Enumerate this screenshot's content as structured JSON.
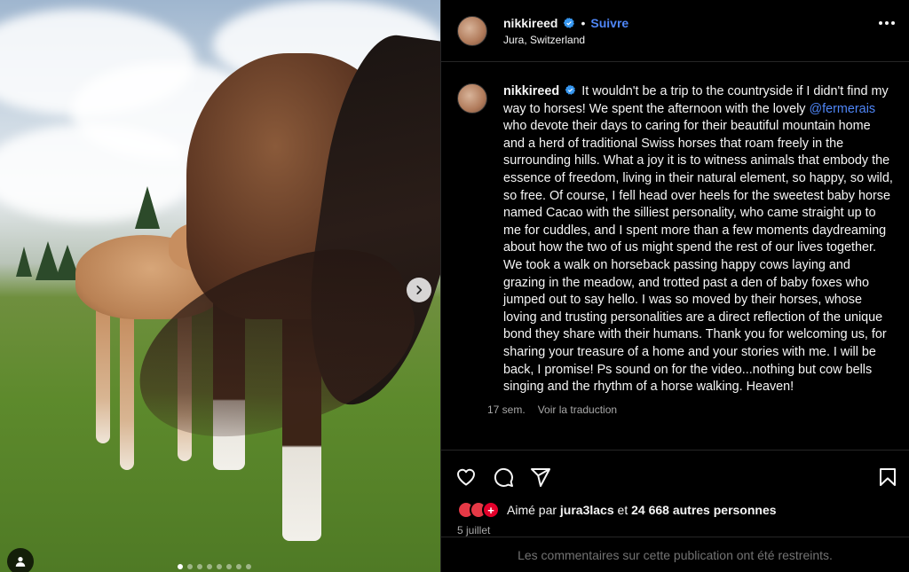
{
  "post": {
    "username": "nikkireed",
    "follow_label": "Suivre",
    "separator": "•",
    "location": "Jura, Switzerland",
    "caption_user": "nikkireed",
    "caption_before_mention": "It wouldn't be a trip to the countryside if I didn't find my way to horses! We spent the afternoon with the lovely ",
    "caption_mention": "@fermerais",
    "caption_after_mention": " who devote their days to caring for their beautiful mountain home and a herd of traditional Swiss horses that roam freely in the surrounding hills. What a joy it is to witness animals that embody the essence of freedom, living in their natural element, so happy, so wild, so free. Of course, I fell head over heels for the sweetest baby horse named Cacao with the silliest personality, who came straight up to me for cuddles, and I spent more than a few moments daydreaming about how the two of us might spend the rest of our lives together. We took a walk on horseback passing happy cows laying and grazing in the meadow, and trotted past a den of baby foxes who jumped out to say hello. I was so moved by their horses, whose loving and trusting personalities are a direct reflection of the unique bond they share with their humans. Thank you for welcoming us, for sharing your treasure of a home and your stories with me. I will be back, I promise! Ps sound on for the video...nothing but cow bells singing and the rhythm of a horse walking. Heaven!",
    "caption_time": "17 sem.",
    "see_translation": "Voir la traduction",
    "likes_prefix": "Aimé par ",
    "likes_user": "jura3lacs",
    "likes_mid": " et ",
    "likes_count": "24 668 autres personnes",
    "date": "5 juillet",
    "comments_restricted": "Les commentaires sur cette publication ont été restreints.",
    "swiss_badge": "+"
  },
  "icons": {
    "verified": "verified-badge-icon",
    "more": "more-options-icon",
    "like": "heart-icon",
    "comment": "comment-icon",
    "share": "share-icon",
    "save": "bookmark-icon",
    "next": "chevron-right-icon",
    "tag": "user-tag-icon"
  },
  "carousel": {
    "slide_count": 8,
    "active_index": 0
  },
  "colors": {
    "accent": "#4f86f7",
    "background": "#000000",
    "muted": "#a8a8a8"
  }
}
